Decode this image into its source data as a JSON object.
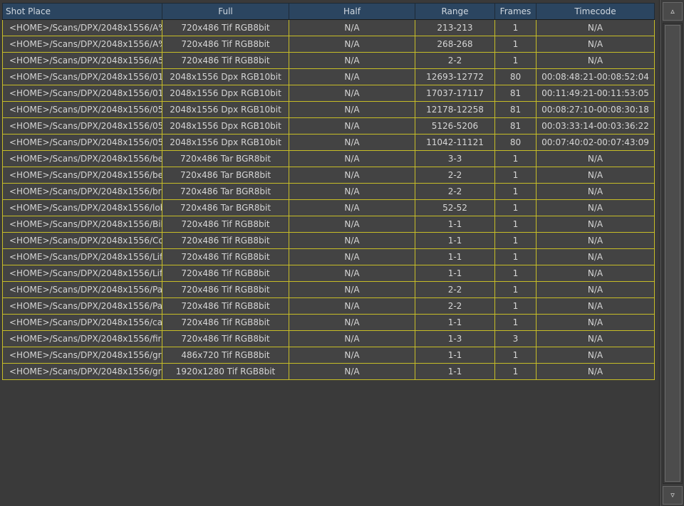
{
  "table": {
    "columns": [
      "Shot Place",
      "Full",
      "Half",
      "Range",
      "Frames",
      "Timecode"
    ],
    "rows": [
      [
        "<HOME>/Scans/DPX/2048x1556/A%",
        "720x486 Tif RGB8bit",
        "N/A",
        "213-213",
        "1",
        "N/A"
      ],
      [
        "<HOME>/Scans/DPX/2048x1556/A%",
        "720x486 Tif RGB8bit",
        "N/A",
        "268-268",
        "1",
        "N/A"
      ],
      [
        "<HOME>/Scans/DPX/2048x1556/A5",
        "720x486 Tif RGB8bit",
        "N/A",
        "2-2",
        "1",
        "N/A"
      ],
      [
        "<HOME>/Scans/DPX/2048x1556/01",
        "2048x1556 Dpx RGB10bit",
        "N/A",
        "12693-12772",
        "80",
        "00:08:48:21-00:08:52:04"
      ],
      [
        "<HOME>/Scans/DPX/2048x1556/01",
        "2048x1556 Dpx RGB10bit",
        "N/A",
        "17037-17117",
        "81",
        "00:11:49:21-00:11:53:05"
      ],
      [
        "<HOME>/Scans/DPX/2048x1556/05",
        "2048x1556 Dpx RGB10bit",
        "N/A",
        "12178-12258",
        "81",
        "00:08:27:10-00:08:30:18"
      ],
      [
        "<HOME>/Scans/DPX/2048x1556/05",
        "2048x1556 Dpx RGB10bit",
        "N/A",
        "5126-5206",
        "81",
        "00:03:33:14-00:03:36:22"
      ],
      [
        "<HOME>/Scans/DPX/2048x1556/05",
        "2048x1556 Dpx RGB10bit",
        "N/A",
        "11042-11121",
        "80",
        "00:07:40:02-00:07:43:09"
      ],
      [
        "<HOME>/Scans/DPX/2048x1556/be",
        "720x486 Tar BGR8bit",
        "N/A",
        "3-3",
        "1",
        "N/A"
      ],
      [
        "<HOME>/Scans/DPX/2048x1556/be",
        "720x486 Tar BGR8bit",
        "N/A",
        "2-2",
        "1",
        "N/A"
      ],
      [
        "<HOME>/Scans/DPX/2048x1556/br",
        "720x486 Tar BGR8bit",
        "N/A",
        "2-2",
        "1",
        "N/A"
      ],
      [
        "<HOME>/Scans/DPX/2048x1556/lob",
        "720x486 Tar BGR8bit",
        "N/A",
        "52-52",
        "1",
        "N/A"
      ],
      [
        "<HOME>/Scans/DPX/2048x1556/Bik",
        "720x486 Tif RGB8bit",
        "N/A",
        "1-1",
        "1",
        "N/A"
      ],
      [
        "<HOME>/Scans/DPX/2048x1556/Co",
        "720x486 Tif RGB8bit",
        "N/A",
        "1-1",
        "1",
        "N/A"
      ],
      [
        "<HOME>/Scans/DPX/2048x1556/Lif",
        "720x486 Tif RGB8bit",
        "N/A",
        "1-1",
        "1",
        "N/A"
      ],
      [
        "<HOME>/Scans/DPX/2048x1556/Lif",
        "720x486 Tif RGB8bit",
        "N/A",
        "1-1",
        "1",
        "N/A"
      ],
      [
        "<HOME>/Scans/DPX/2048x1556/Pal",
        "720x486 Tif RGB8bit",
        "N/A",
        "2-2",
        "1",
        "N/A"
      ],
      [
        "<HOME>/Scans/DPX/2048x1556/Pal",
        "720x486 Tif RGB8bit",
        "N/A",
        "2-2",
        "1",
        "N/A"
      ],
      [
        "<HOME>/Scans/DPX/2048x1556/ca",
        "720x486 Tif RGB8bit",
        "N/A",
        "1-1",
        "1",
        "N/A"
      ],
      [
        "<HOME>/Scans/DPX/2048x1556/fir",
        "720x486 Tif RGB8bit",
        "N/A",
        "1-3",
        "3",
        "N/A"
      ],
      [
        "<HOME>/Scans/DPX/2048x1556/gr",
        "486x720 Tif RGB8bit",
        "N/A",
        "1-1",
        "1",
        "N/A"
      ],
      [
        "<HOME>/Scans/DPX/2048x1556/gr",
        "1920x1280 Tif RGB8bit",
        "N/A",
        "1-1",
        "1",
        "N/A"
      ]
    ]
  },
  "scrollbar": {
    "up_icon": "▵",
    "down_icon": "▿"
  },
  "colors": {
    "header_bg": "#2b4560",
    "row_border": "#c7bd27",
    "row_bg": "#434343",
    "background": "#3a3a3a"
  }
}
